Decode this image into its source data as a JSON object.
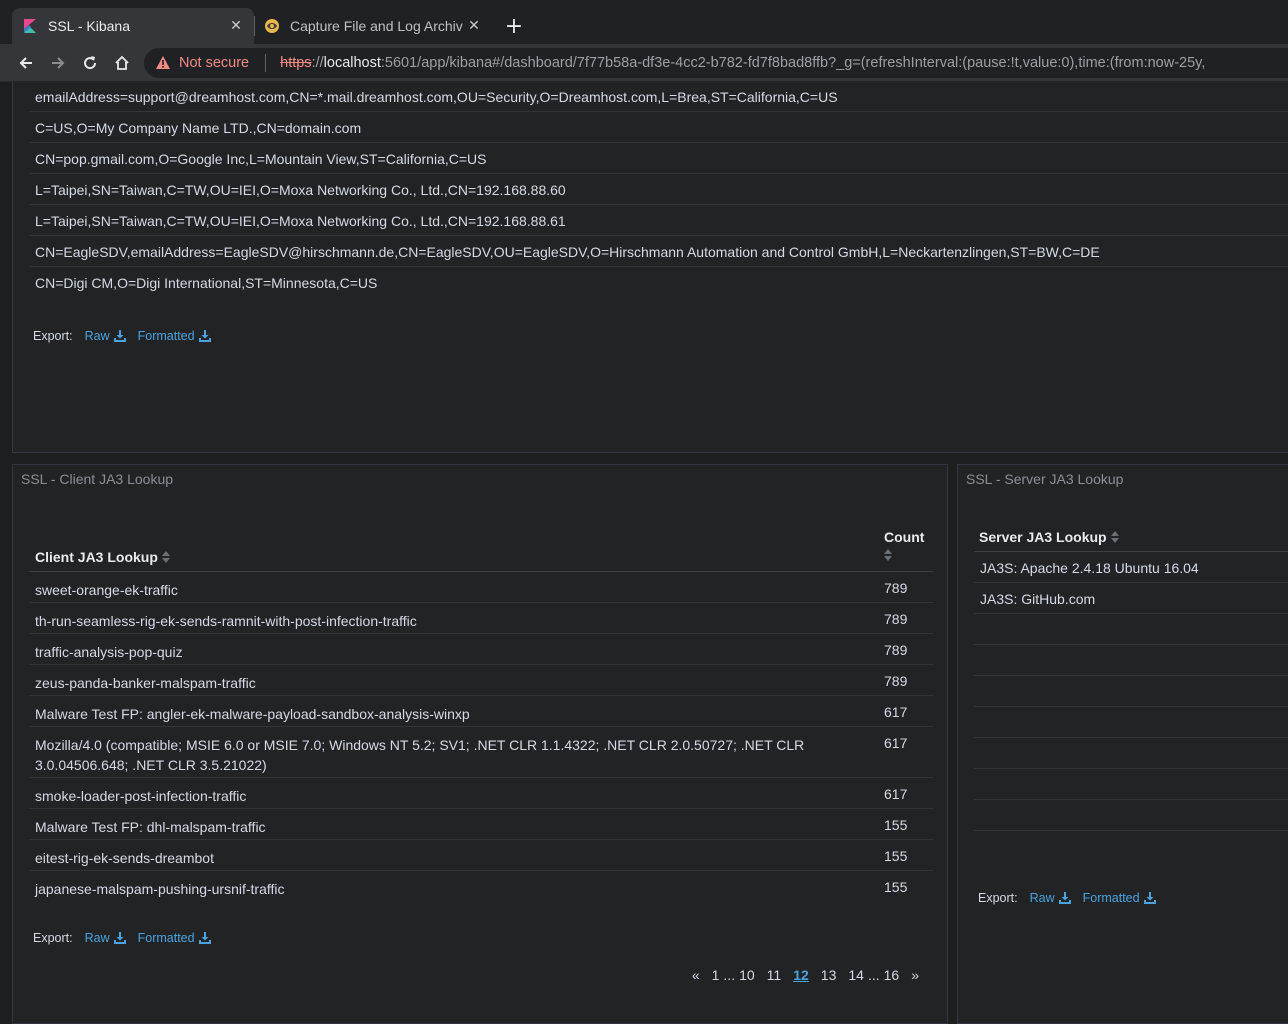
{
  "browser": {
    "tabs": [
      {
        "title": "SSL - Kibana",
        "active": true,
        "icon": "kibana-icon"
      },
      {
        "title": "Capture File and Log Archiv",
        "active": false,
        "icon": "globe-favicon-icon"
      }
    ],
    "url": {
      "security_label": "Not secure",
      "scheme": "https",
      "host": "localhost",
      "rest": ":5601/app/kibana#/dashboard/7f77b58a-df3e-4cc2-b782-fd7f8bad8ffb?_g=(refreshInterval:(pause:!t,value:0),time:(from:now-25y,"
    }
  },
  "top_panel": {
    "rows": [
      "emailAddress=support@dreamhost.com,CN=*.mail.dreamhost.com,OU=Security,O=Dreamhost.com,L=Brea,ST=California,C=US",
      "C=US,O=My Company Name LTD.,CN=domain.com",
      "CN=pop.gmail.com,O=Google Inc,L=Mountain View,ST=California,C=US",
      "L=Taipei,SN=Taiwan,C=TW,OU=IEI,O=Moxa Networking Co., Ltd.,CN=192.168.88.60",
      "L=Taipei,SN=Taiwan,C=TW,OU=IEI,O=Moxa Networking Co., Ltd.,CN=192.168.88.61",
      "CN=EagleSDV,emailAddress=EagleSDV@hirschmann.de,CN=EagleSDV,OU=EagleSDV,O=Hirschmann Automation and Control GmbH,L=Neckartenzlingen,ST=BW,C=DE",
      "CN=Digi CM,O=Digi International,ST=Minnesota,C=US"
    ],
    "export": {
      "label": "Export:",
      "raw": "Raw",
      "formatted": "Formatted"
    }
  },
  "client_panel": {
    "title": "SSL - Client JA3 Lookup",
    "col_name": "Client JA3 Lookup",
    "col_count": "Count",
    "rows": [
      {
        "name": "sweet-orange-ek-traffic",
        "count": "789"
      },
      {
        "name": "th-run-seamless-rig-ek-sends-ramnit-with-post-infection-traffic",
        "count": "789"
      },
      {
        "name": "traffic-analysis-pop-quiz",
        "count": "789"
      },
      {
        "name": "zeus-panda-banker-malspam-traffic",
        "count": "789"
      },
      {
        "name": "Malware Test FP: angler-ek-malware-payload-sandbox-analysis-winxp",
        "count": "617"
      },
      {
        "name": "Mozilla/4.0 (compatible; MSIE 6.0 or MSIE 7.0; Windows NT 5.2; SV1; .NET CLR 1.1.4322; .NET CLR 2.0.50727; .NET CLR 3.0.04506.648; .NET CLR 3.5.21022)",
        "count": "617"
      },
      {
        "name": "smoke-loader-post-infection-traffic",
        "count": "617"
      },
      {
        "name": "Malware Test FP: dhl-malspam-traffic",
        "count": "155"
      },
      {
        "name": "eitest-rig-ek-sends-dreambot",
        "count": "155"
      },
      {
        "name": "japanese-malspam-pushing-ursnif-traffic",
        "count": "155"
      }
    ],
    "export": {
      "label": "Export:",
      "raw": "Raw",
      "formatted": "Formatted"
    },
    "pagination": {
      "prev": "«",
      "first": "1",
      "dots": "...",
      "p10": "10",
      "p11": "11",
      "current": "12",
      "p13": "13",
      "p14": "14",
      "last": "16",
      "next": "»"
    }
  },
  "server_panel": {
    "title": "SSL - Server JA3 Lookup",
    "col_name": "Server JA3 Lookup",
    "rows": [
      "JA3S: Apache 2.4.18 Ubuntu 16.04",
      "JA3S: GitHub.com"
    ],
    "export": {
      "label": "Export:",
      "raw": "Raw",
      "formatted": "Formatted"
    }
  },
  "colors": {
    "link": "#4aa3df",
    "panel_bg": "#222325",
    "page_bg": "#1d1e1f",
    "not_secure": "#f28b82"
  }
}
